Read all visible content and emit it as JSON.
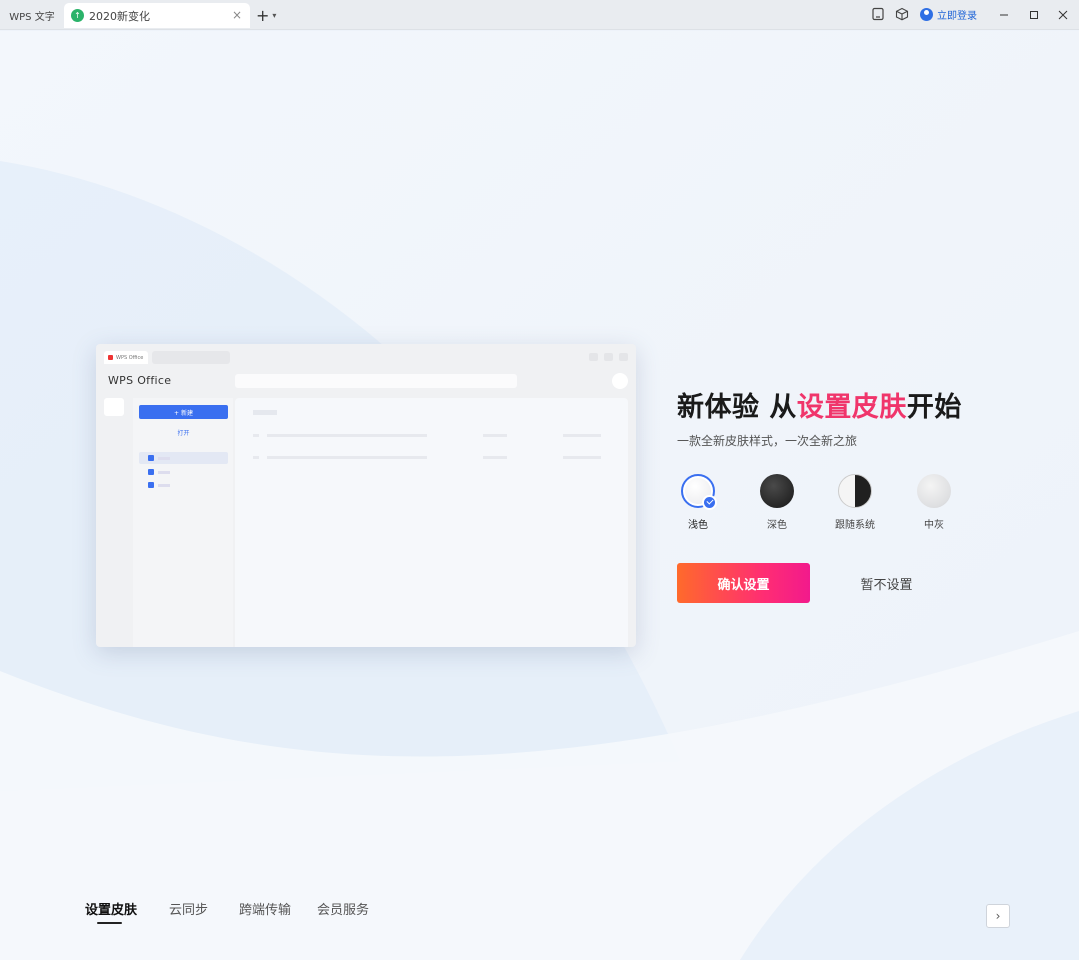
{
  "titlebar": {
    "app_tab": "WPS 文字",
    "doc_tab": "2020新变化",
    "close_glyph": "×",
    "new_tab_glyph": "+",
    "login_label": "立即登录",
    "icons": [
      "tablet-icon",
      "cube-icon",
      "user-icon",
      "minimize-icon",
      "maximize-icon",
      "close-icon"
    ]
  },
  "preview": {
    "tab_label": "WPS Office",
    "title": "WPS Office",
    "new_label": "+ 新建",
    "open_label": "打开"
  },
  "main": {
    "headline_pre": "新体验 从",
    "headline_highlight": "设置皮肤",
    "headline_post": "开始",
    "subline": "一款全新皮肤样式，一次全新之旅",
    "skins": [
      {
        "label": "浅色",
        "selected": true
      },
      {
        "label": "深色",
        "selected": false
      },
      {
        "label": "跟随系统",
        "selected": false
      },
      {
        "label": "中灰",
        "selected": false
      }
    ],
    "confirm_label": "确认设置",
    "later_label": "暂不设置",
    "accent_color": "#f0356b",
    "button_gradient": [
      "#ff6a2b",
      "#ff2d73",
      "#f21a8c"
    ],
    "selection_color": "#3a6ff0"
  },
  "bottom": {
    "tabs": [
      "设置皮肤",
      "云同步",
      "跨端传输",
      "会员服务"
    ],
    "active_tab": 0,
    "next_glyph": "›"
  }
}
